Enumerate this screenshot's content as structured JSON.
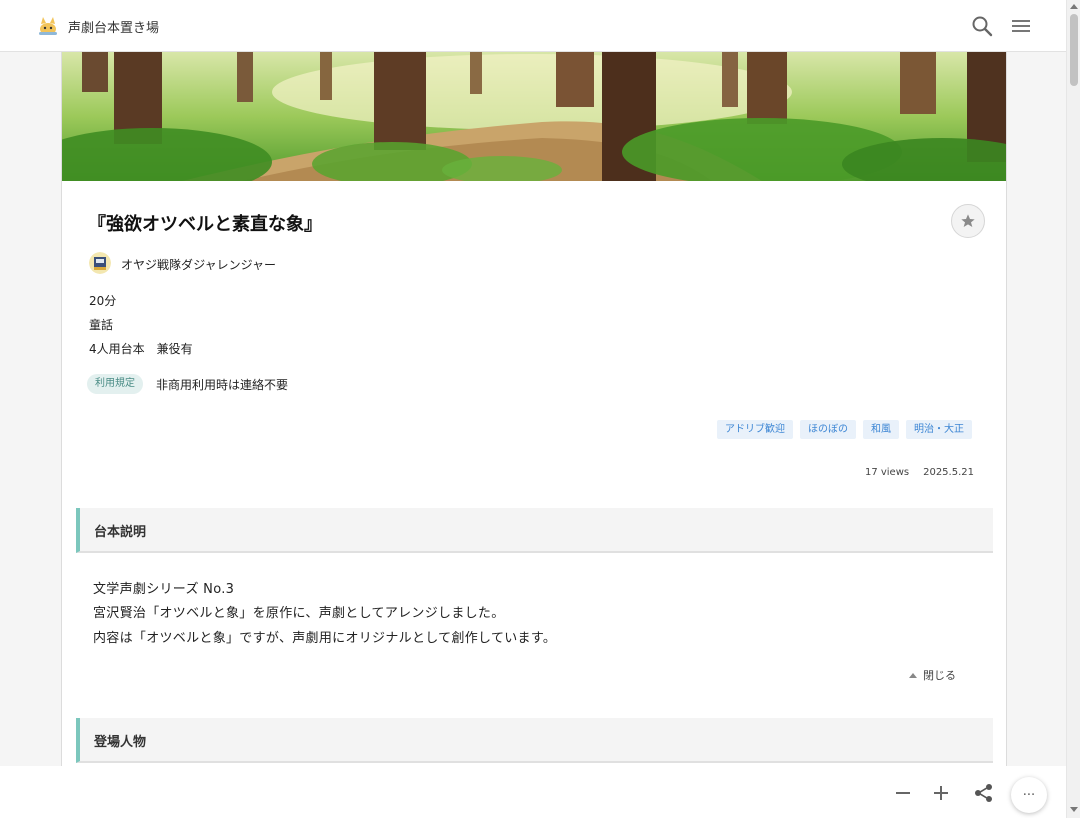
{
  "header": {
    "site_title": "声劇台本置き場",
    "icons": [
      "logo-cat-icon",
      "search-icon",
      "hamburger-menu-icon"
    ]
  },
  "script": {
    "title": "『強欲オツベルと素直な象』",
    "author": "オヤジ戦隊ダジャレンジャー",
    "duration": "20分",
    "genre": "童話",
    "cast": "4人用台本　兼役有",
    "license_label": "利用規定",
    "license_text": "非商用利用時は連絡不要",
    "tags": [
      "アドリブ歓迎",
      "ほのぼの",
      "和風",
      "明治・大正"
    ],
    "views": "17 views",
    "date": "2025.5.21"
  },
  "sections": {
    "description_title": "台本説明",
    "description_lines": [
      "文学声劇シリーズ No.3",
      "宮沢賢治「オツベルと象」を原作に、声劇としてアレンジしました。",
      "内容は「オツベルと象」ですが、声劇用にオリジナルとして創作しています。"
    ],
    "close_label": "閉じる",
    "characters_title": "登場人物"
  },
  "toolbar": {
    "icons": [
      "minus-icon",
      "plus-icon",
      "share-icon",
      "more-icon"
    ],
    "more_label": "···"
  },
  "colors": {
    "accent": "#7cc7bd",
    "tag_text": "#3d86d4",
    "tag_bg": "#e9f1fa",
    "badge_bg": "#e3f0ef",
    "badge_text": "#4a8c86"
  }
}
